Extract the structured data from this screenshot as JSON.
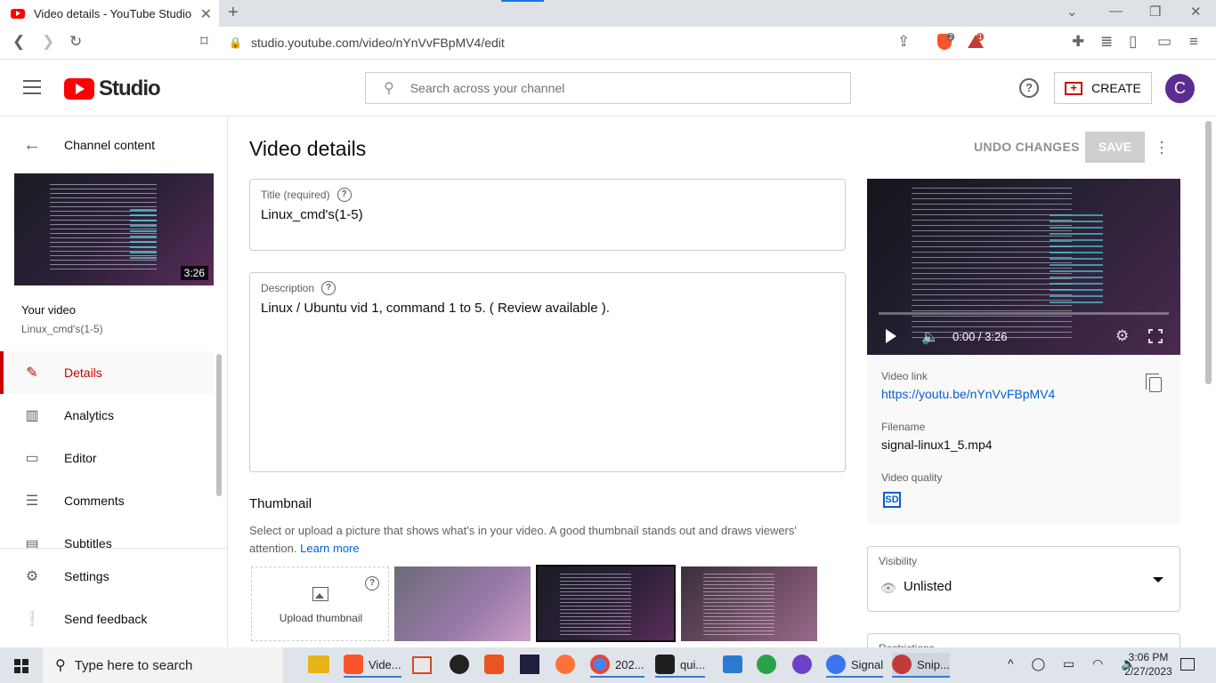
{
  "browser": {
    "tab_title": "Video details - YouTube Studio",
    "new_tab": "+",
    "url": "studio.youtube.com/video/nYnVvFBpMV4/edit",
    "brave_badge": "2",
    "alert_badge": "1"
  },
  "header": {
    "logo_text": "Studio",
    "search_placeholder": "Search across your channel",
    "help": "?",
    "create_label": "CREATE",
    "avatar_letter": "C"
  },
  "sidebar": {
    "back_label": "Channel content",
    "thumb_duration": "3:26",
    "your_video": "Your video",
    "video_title": "Linux_cmd's(1-5)",
    "items": [
      {
        "label": "Details",
        "icon": "pencil-icon"
      },
      {
        "label": "Analytics",
        "icon": "analytics-icon"
      },
      {
        "label": "Editor",
        "icon": "editor-icon"
      },
      {
        "label": "Comments",
        "icon": "comments-icon"
      },
      {
        "label": "Subtitles",
        "icon": "subtitles-icon"
      }
    ],
    "settings": "Settings",
    "feedback": "Send feedback"
  },
  "main": {
    "page_title": "Video details",
    "undo": "UNDO CHANGES",
    "save": "SAVE",
    "title_label": "Title (required)",
    "title_value": "Linux_cmd's(1-5)",
    "desc_label": "Description",
    "desc_value": "Linux / Ubuntu vid 1, command 1 to 5. ( Review available ).",
    "thumb_heading": "Thumbnail",
    "thumb_desc": "Select or upload a picture that shows what's in your video. A good thumbnail stands out and draws viewers' attention.",
    "learn_more": "Learn more",
    "upload_thumb": "Upload thumbnail"
  },
  "preview": {
    "time": "0:00 / 3:26",
    "progress": 0,
    "link_label": "Video link",
    "link": "https://youtu.be/nYnVvFBpMV4",
    "filename_label": "Filename",
    "filename": "signal-linux1_5.mp4",
    "quality_label": "Video quality",
    "quality": "SD",
    "visibility_label": "Visibility",
    "visibility": "Unlisted",
    "restrictions_label": "Restrictions"
  },
  "taskbar": {
    "search": "Type here to search",
    "apps": [
      {
        "label": "Vide...",
        "color": "#fb542b"
      },
      {
        "label": "202...",
        "color": "#4285f4"
      },
      {
        "label": "qui...",
        "color": "#1f1f1f"
      },
      {
        "label": "Signal",
        "color": "#3a76f0"
      },
      {
        "label": "Snip...",
        "color": "#c23a3a"
      }
    ],
    "time": "3:06 PM",
    "date": "2/27/2023"
  },
  "colors": {
    "accent_red": "#cc0000",
    "link_blue": "#065fd4",
    "avatar": "#5c2d91"
  }
}
